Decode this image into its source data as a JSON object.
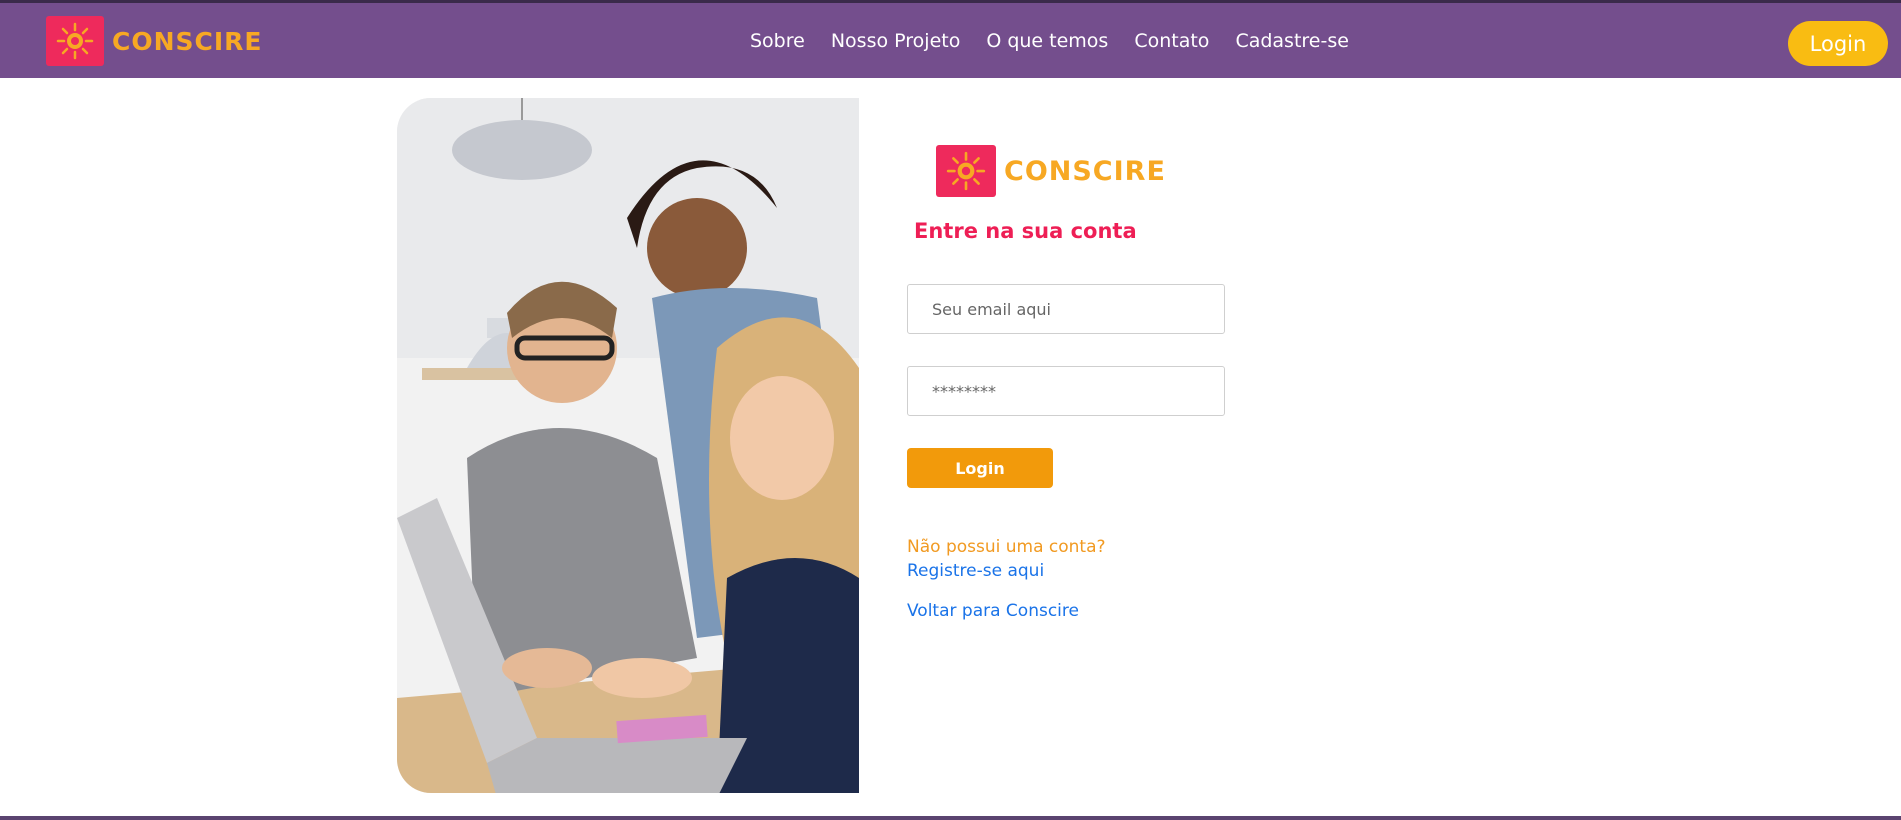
{
  "brand": {
    "name": "CONSCIRE",
    "icon": "sun-logo-icon"
  },
  "nav": {
    "links": [
      "Sobre",
      "Nosso Projeto",
      "O que temos",
      "Contato",
      "Cadastre-se"
    ],
    "login_label": "Login"
  },
  "login_form": {
    "heading": "Entre na sua conta",
    "email_placeholder": "Seu email aqui",
    "password_placeholder": "********",
    "submit_label": "Login",
    "no_account_text": "Não possui uma conta?",
    "register_link": "Registre-se aqui",
    "back_link": "Voltar para Conscire"
  },
  "colors": {
    "navbar": "#744e8d",
    "brand_box": "#ee2a5c",
    "brand_text": "#f7a823",
    "nav_login": "#f9bc12",
    "heading": "#ee1e55",
    "submit": "#f29a0b",
    "link": "#1a73e8"
  }
}
